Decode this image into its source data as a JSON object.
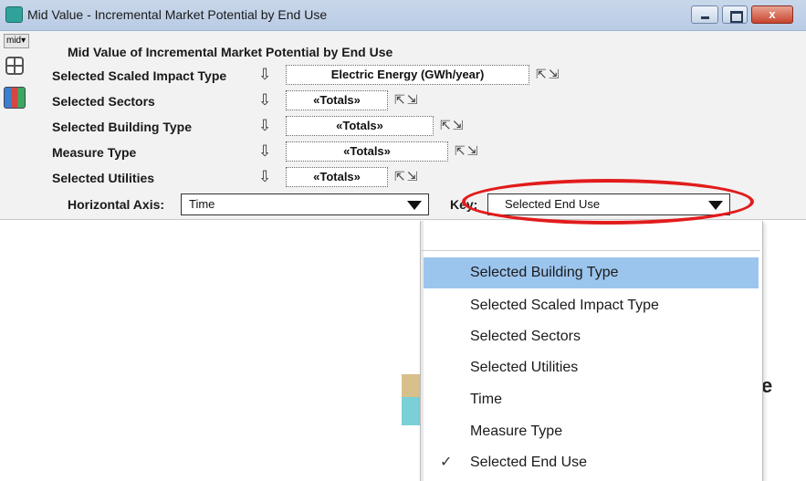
{
  "window": {
    "title": "Mid Value - Incremental Market Potential by End Use",
    "buttons": {
      "minimize": "",
      "maximize": "",
      "close": "x"
    }
  },
  "toolstrip": {
    "mid_label": "mid▾"
  },
  "panel": {
    "heading": "Mid Value of Incremental Market Potential by End Use",
    "rows": [
      {
        "label": "Selected Scaled Impact Type",
        "value": "Electric Energy (GWh/year)"
      },
      {
        "label": "Selected Sectors",
        "value": "«Totals»"
      },
      {
        "label": "Selected Building Type",
        "value": "«Totals»"
      },
      {
        "label": "Measure Type",
        "value": "«Totals»"
      },
      {
        "label": "Selected Utilities",
        "value": "«Totals»"
      }
    ],
    "row_arrow": "⇩",
    "row_icons": "⇱⇲",
    "horizontal_axis_label": "Horizontal Axis:",
    "horizontal_axis_value": "Time",
    "key_label": "Key:",
    "key_value": "Selected End Use"
  },
  "dropdown": {
    "items": [
      {
        "label": "Selected Building Type",
        "highlighted": true,
        "checked": false
      },
      {
        "label": "Selected Scaled Impact Type",
        "highlighted": false,
        "checked": false
      },
      {
        "label": "Selected Sectors",
        "highlighted": false,
        "checked": false
      },
      {
        "label": "Selected Utilities",
        "highlighted": false,
        "checked": false
      },
      {
        "label": "Time",
        "highlighted": false,
        "checked": false
      },
      {
        "label": "Measure Type",
        "highlighted": false,
        "checked": false
      },
      {
        "label": "Selected End Use",
        "highlighted": false,
        "checked": true
      }
    ],
    "check_glyph": "✓"
  },
  "background": {
    "partial_text": "e"
  },
  "colors": {
    "highlight": "#9cc5ee",
    "annotation_circle": "#e21b1b",
    "title_bar": "#c9d7ea"
  }
}
